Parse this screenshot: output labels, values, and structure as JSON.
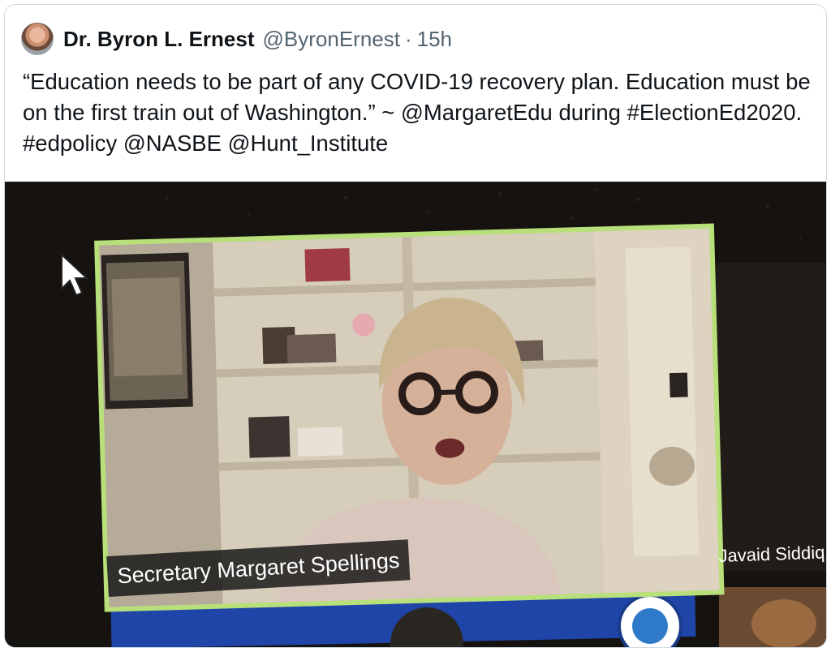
{
  "tweet": {
    "display_name": "Dr. Byron L. Ernest",
    "handle": "@ByronErnest",
    "separator": "·",
    "time": "15h",
    "text": "“Education needs to be part of any COVID-19 recovery plan. Education must be on the first train out of Washington.” ~ @MargaretEdu during #ElectionEd2020. #edpolicy @NASBE @Hunt_Institute"
  },
  "media": {
    "speaker_name": "Secretary Margaret Spellings",
    "side_participant_name": "Javaid Siddiq",
    "active_speaker_border_color": "#b8e07a"
  }
}
